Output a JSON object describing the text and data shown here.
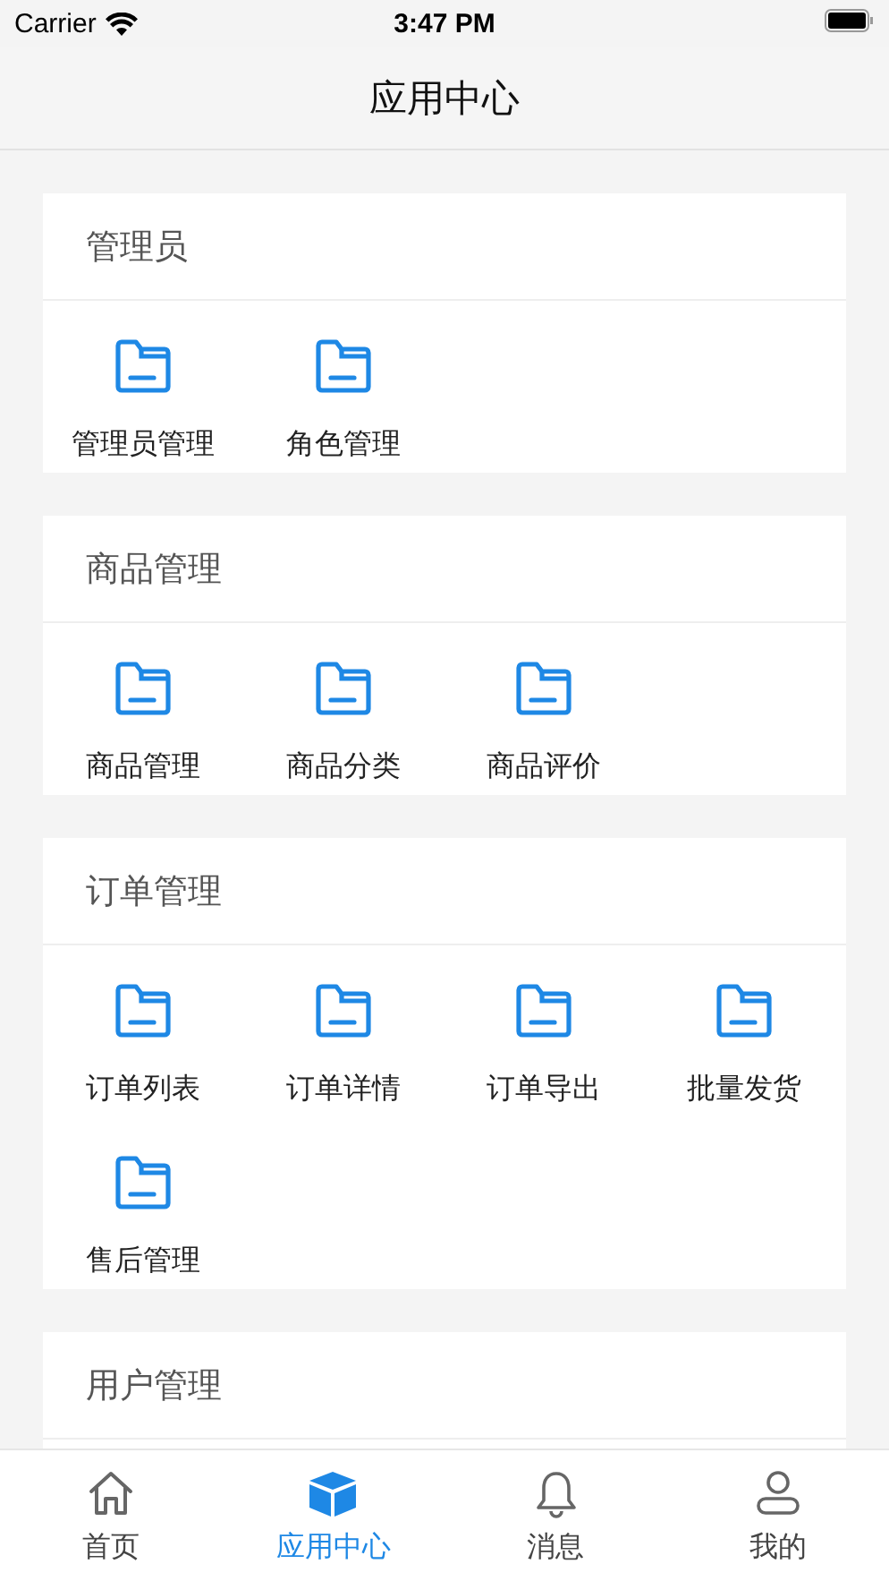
{
  "status_bar": {
    "carrier": "Carrier",
    "time": "3:47 PM"
  },
  "nav_bar": {
    "title": "应用中心"
  },
  "sections": [
    {
      "title": "管理员",
      "items": [
        "管理员管理",
        "角色管理"
      ]
    },
    {
      "title": "商品管理",
      "items": [
        "商品管理",
        "商品分类",
        "商品评价"
      ]
    },
    {
      "title": "订单管理",
      "items": [
        "订单列表",
        "订单详情",
        "订单导出",
        "批量发货",
        "售后管理"
      ]
    },
    {
      "title": "用户管理"
    }
  ],
  "tab_bar": [
    {
      "label": "首页",
      "kind": "home",
      "selected": false
    },
    {
      "label": "应用中心",
      "kind": "cube",
      "selected": true
    },
    {
      "label": "消息",
      "kind": "bell",
      "selected": false
    },
    {
      "label": "我的",
      "kind": "person",
      "selected": false
    }
  ]
}
